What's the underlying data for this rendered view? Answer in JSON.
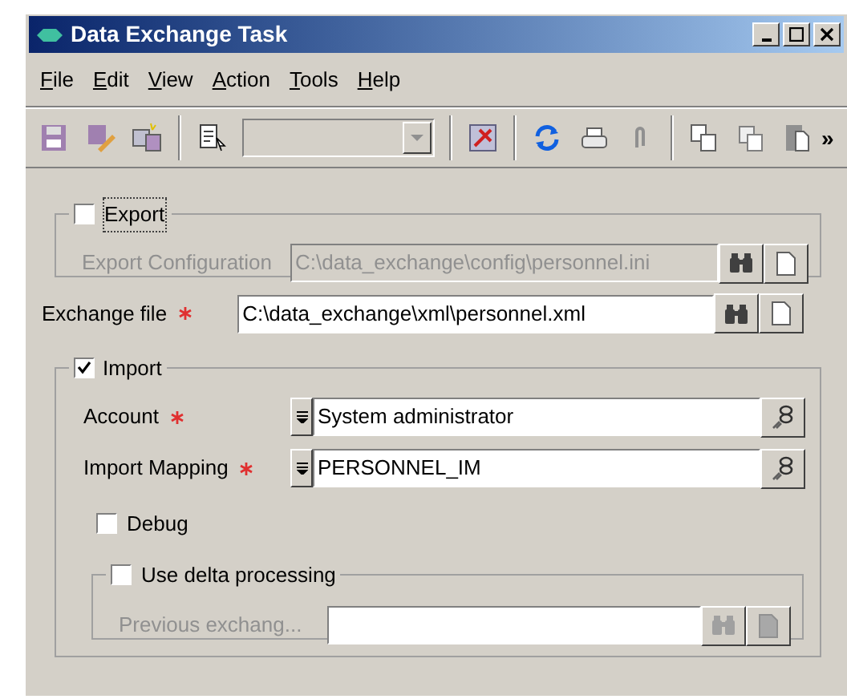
{
  "window": {
    "title": "Data Exchange Task"
  },
  "menu": [
    "File",
    "Edit",
    "View",
    "Action",
    "Tools",
    "Help"
  ],
  "toolbar": {
    "overflow": "»"
  },
  "export": {
    "label": "Export",
    "checked": false,
    "configuration": {
      "label": "Export Configuration",
      "value": "C:\\data_exchange\\config\\personnel.ini",
      "disabled": true
    }
  },
  "exchange_file": {
    "label": "Exchange file",
    "required": true,
    "value": "C:\\data_exchange\\xml\\personnel.xml"
  },
  "import": {
    "label": "Import",
    "checked": true,
    "account": {
      "label": "Account",
      "required": true,
      "value": "System administrator"
    },
    "mapping": {
      "label": "Import Mapping",
      "required": true,
      "value": "PERSONNEL_IM"
    },
    "debug": {
      "label": "Debug",
      "checked": false
    },
    "delta": {
      "label": "Use delta processing",
      "checked": false,
      "previous": {
        "label": "Previous exchang...",
        "disabled": true
      }
    }
  }
}
